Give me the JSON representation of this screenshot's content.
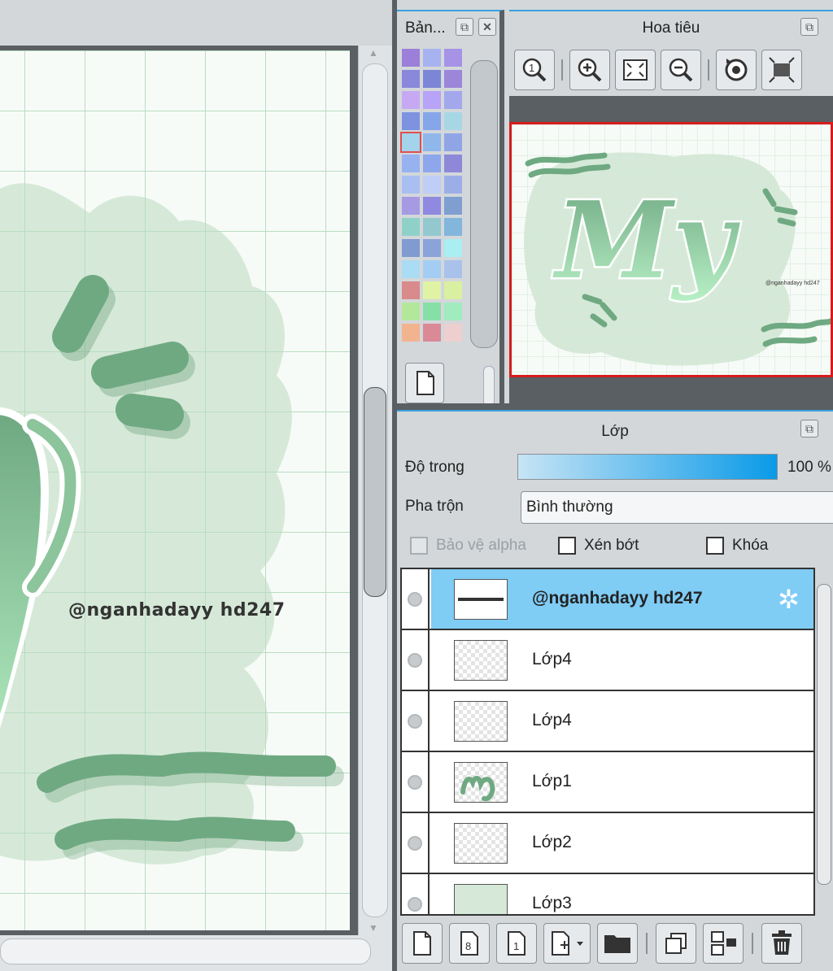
{
  "canvas": {
    "credit_text": "@nganhadayy hd247"
  },
  "palette_panel": {
    "title": "Bản...",
    "float_icon": "float-window-icon",
    "close_icon": "close-icon",
    "swatches": [
      "#9b7fd8",
      "#a7b3f0",
      "#a693e6",
      "#8a88db",
      "#7c86d6",
      "#9b86d9",
      "#c6a9f2",
      "#b7a3f7",
      "#a3a7ec",
      "#7d93e0",
      "#86a6ea",
      "#a7d7e4",
      "#a4d3ec",
      "#8fb7ec",
      "#8fa5e6",
      "#97b3ef",
      "#8ea6ec",
      "#8d89d8",
      "#a9bff2",
      "#bfcdf7",
      "#9caee8",
      "#a69be3",
      "#8f8ae0",
      "#7e9fd0",
      "#8fd1c9",
      "#93c8cf",
      "#82b6dc",
      "#7f9bd0",
      "#8aa3d9",
      "#a8eef3",
      "#aadcf3",
      "#a3cdf3",
      "#a9c2ec",
      "#d98a8a",
      "#e0f3a4",
      "#d9f0a0",
      "#b3e89b",
      "#86e0a6",
      "#a0ecbf",
      "#f2b38f",
      "#d98a96",
      "#edcfcf"
    ],
    "selected_index": 12,
    "new_button_icon": "new-page-icon"
  },
  "navigator_panel": {
    "title": "Hoa tiêu",
    "tools": [
      "zoom-100-icon",
      "zoom-in-icon",
      "fit-window-icon",
      "zoom-out-icon",
      "rotate-reset-icon",
      "fit-canvas-icon"
    ],
    "preview_text": "My",
    "preview_credit": "@nganhadayy hd247"
  },
  "layer_panel": {
    "title": "Lớp",
    "opacity_label": "Độ trong",
    "opacity_value": "100 %",
    "opacity_level": 1.0,
    "blend_label": "Pha trộn",
    "blend_value": "Bình thường",
    "checkboxes": {
      "protect_alpha": "Bảo vệ alpha",
      "clip": "Xén bớt",
      "lock": "Khóa"
    },
    "layers": [
      {
        "name": "@nganhadayy hd247",
        "active": true
      },
      {
        "name": "Lớp4",
        "active": false
      },
      {
        "name": "Lớp4",
        "active": false
      },
      {
        "name": "Lớp1",
        "active": false
      },
      {
        "name": "Lớp2",
        "active": false
      },
      {
        "name": "Lớp3",
        "active": false
      }
    ],
    "toolbar": [
      "new-layer-icon",
      "new-8bit-layer-icon",
      "new-1bit-layer-icon",
      "add-layer-menu-icon",
      "folder-icon",
      "duplicate-layer-icon",
      "merge-down-icon",
      "delete-icon"
    ],
    "toolbar_labels": {
      "eight": "8",
      "one": "1"
    }
  },
  "colors": {
    "accent": "#3aa0e0",
    "active_layer": "#7fccf5",
    "art_green": "#6fa982",
    "blob_green": "#d6e9d8",
    "grid": "#b9dcc2"
  }
}
